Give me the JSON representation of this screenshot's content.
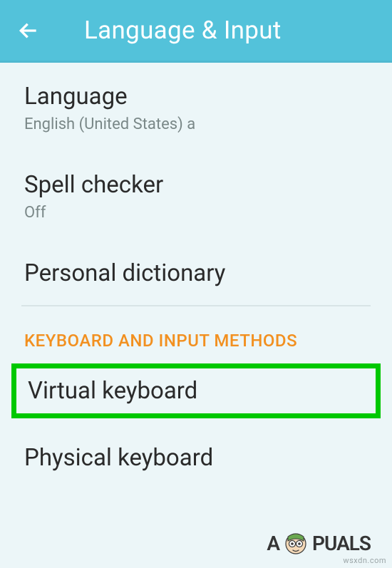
{
  "header": {
    "title": "Language & Input"
  },
  "items": {
    "language": {
      "title": "Language",
      "subtitle": "English (United States) a"
    },
    "spell_checker": {
      "title": "Spell checker",
      "subtitle": "Off"
    },
    "personal_dictionary": {
      "title": "Personal dictionary"
    },
    "section_keyboard": {
      "label": "KEYBOARD AND INPUT METHODS"
    },
    "virtual_keyboard": {
      "title": "Virtual keyboard"
    },
    "physical_keyboard": {
      "title": "Physical keyboard"
    }
  },
  "branding": {
    "logo_text_left": "A",
    "logo_text_right": "PUALS",
    "watermark": "wsxdn.com"
  }
}
